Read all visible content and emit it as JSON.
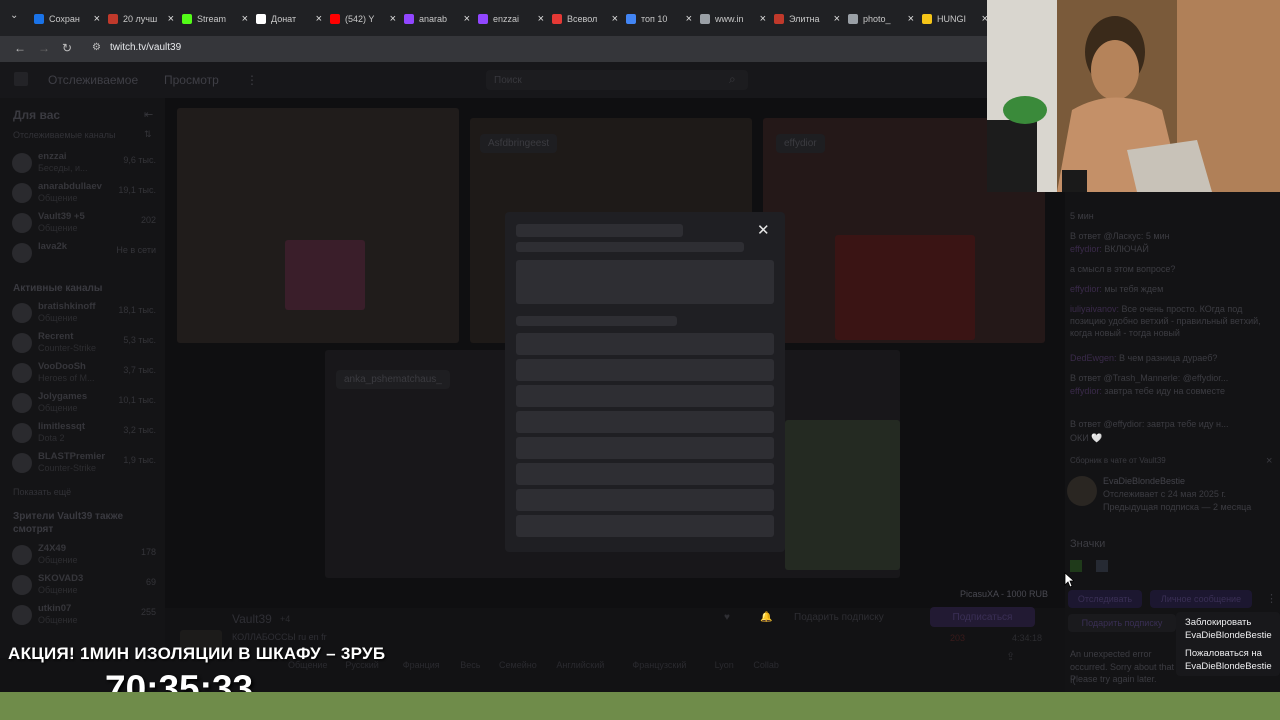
{
  "browser": {
    "tabs": [
      {
        "label": "Сохран",
        "color": "#1a73e8"
      },
      {
        "label": "20 лучш",
        "color": "#c0392b"
      },
      {
        "label": "Stream",
        "color": "#53fc18"
      },
      {
        "label": "Донат",
        "color": "#ffffff"
      },
      {
        "label": "(542) Y",
        "color": "#ff0000"
      },
      {
        "label": "anarab",
        "color": "#9146ff"
      },
      {
        "label": "enzzai",
        "color": "#9146ff"
      },
      {
        "label": "Всевол",
        "color": "#e53935"
      },
      {
        "label": "топ 10",
        "color": "#4285f4"
      },
      {
        "label": "www.in",
        "color": "#9aa0a6"
      },
      {
        "label": "Элитна",
        "color": "#c0392b"
      },
      {
        "label": "photo_",
        "color": "#9aa0a6"
      },
      {
        "label": "HUNGI",
        "color": "#f5c518"
      }
    ],
    "url": "twitch.tv/vault39"
  },
  "twitch": {
    "nav": {
      "following": "Отслеживаемое",
      "browse": "Просмотр",
      "search_placeholder": "Поиск"
    },
    "sidebar": {
      "for_you": "Для вас",
      "followed_header": "Отслеживаемые каналы",
      "followed": [
        {
          "name": "enzzai",
          "game": "Беседы, и...",
          "viewers": "9,6 тыс."
        },
        {
          "name": "anarabdullaev",
          "game": "Общение",
          "viewers": "19,1 тыс."
        },
        {
          "name": "Vault39 +5",
          "game": "Общение",
          "viewers": "202"
        },
        {
          "name": "lava2k",
          "game": "",
          "viewers": "Не в сети"
        }
      ],
      "active_header": "Активные каналы",
      "active": [
        {
          "name": "bratishkinoff",
          "game": "Общение",
          "viewers": "18,1 тыс."
        },
        {
          "name": "Recrent",
          "game": "Counter-Strike",
          "viewers": "5,3 тыс."
        },
        {
          "name": "VooDooSh",
          "game": "Heroes of M...",
          "viewers": "3,7 тыс."
        },
        {
          "name": "Jolygames",
          "game": "Общение",
          "viewers": "10,1 тыс."
        },
        {
          "name": "limitlessqt",
          "game": "Dota 2",
          "viewers": "3,2 тыс."
        },
        {
          "name": "BLASTPremier",
          "game": "Counter-Strike",
          "viewers": "1,9 тыс."
        }
      ],
      "show_more": "Показать ещё",
      "viewers_also_header": "Зрители Vault39 также смотрят",
      "also": [
        {
          "name": "Z4X49",
          "game": "Общение",
          "viewers": "178"
        },
        {
          "name": "SKOVAD3",
          "game": "Общение",
          "viewers": "69"
        },
        {
          "name": "utkin07",
          "game": "Общение",
          "viewers": "255"
        }
      ]
    },
    "tiles": {
      "tag1": "Asfdbringeest",
      "tag2": "effydior",
      "tag3": "anka_pshematchaus_"
    },
    "stream": {
      "streamer": "Vault39",
      "extra": "+4",
      "title": "КОЛЛАБОССЫ ru en fr",
      "gift_sub": "Подарить подписку",
      "subscribe": "Подписаться",
      "viewers": "203",
      "uptime": "4:34:18",
      "donation": "PicasuXA - 1000 RUB",
      "tags": [
        "Общение",
        "Русский",
        "Франция",
        "Весь",
        "Семейно",
        "Английский",
        "Французский",
        "Lyon",
        "Collab"
      ]
    },
    "chat": {
      "lines": [
        {
          "user": "",
          "text": "5 мин"
        },
        {
          "user": "",
          "text": "В ответ @Ласкус: 5 мин"
        },
        {
          "user": "effydior:",
          "text": "ВКЛЮЧАЙ"
        },
        {
          "user": "",
          "text": "а смысл в этом вопросе?"
        },
        {
          "user": "effydior:",
          "text": "мы тебя ждем"
        },
        {
          "user": "iuliyaivanov:",
          "text": "Все очень просто. КОгда под позицию удобно ветхий - правильный ветхий, когда новый - тогда новый"
        },
        {
          "user": "DedEwgen:",
          "text": "В чем разница дураеб?"
        },
        {
          "user": "",
          "text": "В ответ @Trash_Mannerle: @effydior..."
        },
        {
          "user": "effydior:",
          "text": "завтра тебе иду на совместе"
        },
        {
          "user": "",
          "text": "В ответ @effydior: завтра тебе иду н..."
        },
        {
          "user": "",
          "text": "ОКИ 🤍"
        }
      ],
      "card": {
        "header": "Сборник в чате от Vault39",
        "user": "EvaDieBlondeBestie",
        "following": "Отслеживает с 24 мая 2025 г.",
        "prev_sub": "Предыдущая подписка — 2 месяца",
        "badges": "Значки",
        "follow_btn": "Отследивать",
        "message_btn": "Личное сообщение",
        "gift_btn": "Подарить подписку",
        "error": "An unexpected error occurred. Sorry about that :(",
        "retry": "Please try again later."
      }
    }
  },
  "context_menu": {
    "block": "Заблокировать",
    "block_user": "EvaDieBlondeBestie",
    "report": "Пожаловаться на",
    "report_user": "EvaDieBlondeBestie"
  },
  "overlay": {
    "promo": "АКЦИЯ! 1МИН ИЗОЛЯЦИИ В ШКАФУ – 3РУБ",
    "timer": "70:35:33"
  }
}
